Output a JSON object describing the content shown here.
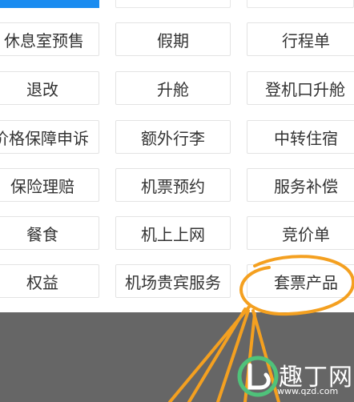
{
  "grid": {
    "rows": [
      [
        "休息室预售",
        "假期",
        "行程单"
      ],
      [
        "退改",
        "升舱",
        "登机口升舱"
      ],
      [
        "价格保障申诉",
        "额外行李",
        "中转住宿"
      ],
      [
        "保险理赔",
        "机票预约",
        "服务补偿"
      ],
      [
        "餐食",
        "机上上网",
        "竞价单"
      ],
      [
        "权益",
        "机场贵宾服务",
        "套票产品"
      ]
    ]
  },
  "watermark": {
    "text": "趣丁网",
    "url": "www.qzd.com"
  },
  "colors": {
    "accent": "#1a8cf0",
    "annotation": "#f4a020",
    "overlay": "#666666",
    "watermark_logo": "#4fc27a"
  }
}
